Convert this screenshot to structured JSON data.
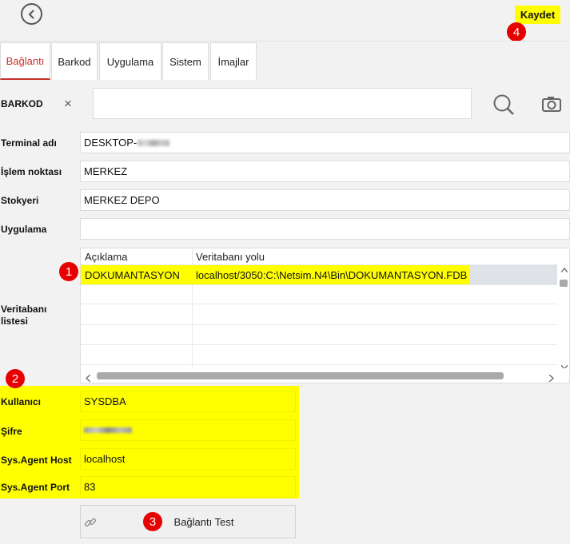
{
  "header": {
    "save_label": "Kaydet"
  },
  "badges": {
    "b1": "1",
    "b2": "2",
    "b3": "3",
    "b4": "4"
  },
  "tabs": [
    {
      "label": "Bağlantı",
      "active": true
    },
    {
      "label": "Barkod"
    },
    {
      "label": "Uygulama"
    },
    {
      "label": "Sistem"
    },
    {
      "label": "İmajlar"
    }
  ],
  "barcode": {
    "label": "BARKOD",
    "clear_symbol": "×",
    "value": ""
  },
  "form": {
    "terminal_label": "Terminal adı",
    "terminal_value": "DESKTOP-",
    "point_label": "İşlem noktası",
    "point_value": "MERKEZ",
    "stock_label": "Stokyeri",
    "stock_value": "MERKEZ DEPO",
    "app_label": "Uygulama",
    "app_value": "",
    "db_list_label": "Veritabanı listesi",
    "user_label": "Kullanıcı",
    "user_value": "SYSDBA",
    "password_label": "Şifre",
    "host_label": "Sys.Agent Host",
    "host_value": "localhost",
    "port_label": "Sys.Agent Port",
    "port_value": "83"
  },
  "grid": {
    "columns": [
      "Açıklama",
      "Veritabanı yolu"
    ],
    "rows": [
      [
        "DOKUMANTASYON",
        "localhost/3050:C:\\Netsim.N4\\Bin\\DOKUMANTASYON.FDB"
      ]
    ]
  },
  "test_button_label": "Bağlantı Test",
  "colors": {
    "highlight": "#ffff00",
    "badge": "#e60000",
    "accent": "#c8322c"
  },
  "icons": [
    "back-arrow-icon",
    "search-icon",
    "camera-icon",
    "link-icon"
  ]
}
